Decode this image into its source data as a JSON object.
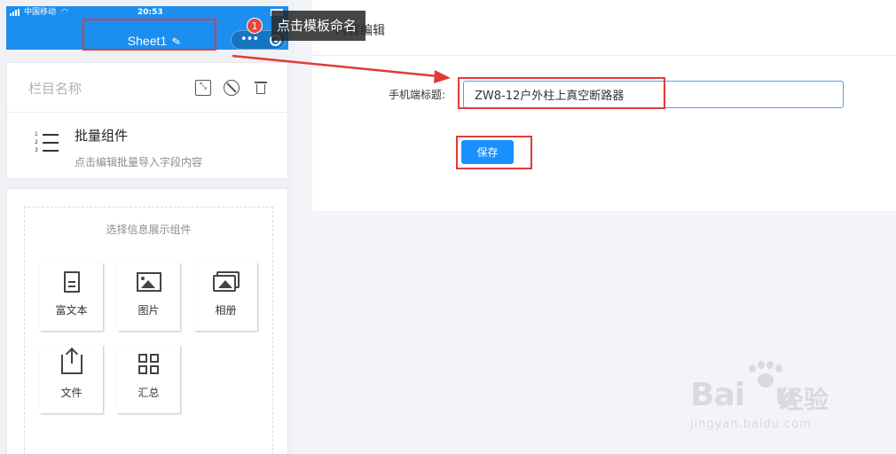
{
  "status_bar": {
    "carrier": "中国移动",
    "time": "20:53"
  },
  "header": {
    "sheet_name": "Sheet1",
    "badge_count": "1",
    "tooltip": "点击模板命名"
  },
  "column": {
    "name_placeholder": "栏目名称",
    "batch_title": "批量组件",
    "batch_desc": "点击编辑批量导入字段内容"
  },
  "widgets": {
    "title": "选择信息展示组件",
    "items": [
      {
        "label": "富文本",
        "icon": "document-icon"
      },
      {
        "label": "图片",
        "icon": "image-icon"
      },
      {
        "label": "相册",
        "icon": "album-icon"
      },
      {
        "label": "文件",
        "icon": "upload-icon"
      },
      {
        "label": "汇总",
        "icon": "grid-icon"
      }
    ]
  },
  "editor": {
    "heading": "内容编辑",
    "field_label": "手机端标题:",
    "title_value": "ZW8-12户外柱上真空断路器",
    "save_label": "保存"
  },
  "watermark": {
    "logo": "Bai",
    "logo_end": "u",
    "brand_cn": "经验",
    "url": "jingyan.baidu.com"
  },
  "colors": {
    "primary": "#1890ff",
    "header_blue": "#1b8ef0",
    "annotation_red": "#e03b3b"
  }
}
